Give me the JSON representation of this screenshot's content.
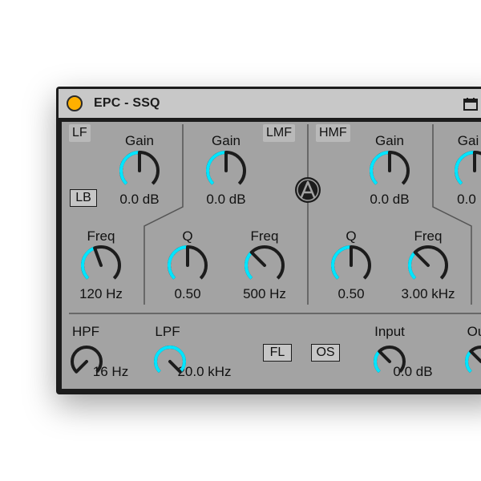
{
  "device": {
    "title": "EPC - SSQ",
    "accent": "#00e5ff",
    "power_color": "#ffb000",
    "icons": {
      "save": "save-icon",
      "more": "more-icon",
      "logo": "brand-logo-icon"
    }
  },
  "bands": {
    "lf": {
      "tag": "LF",
      "gain_label": "Gain",
      "gain_value": "0.0 dB",
      "freq_label": "Freq",
      "freq_value": "120 Hz",
      "lb_label": "LB"
    },
    "lmf": {
      "tag": "LMF",
      "gain_label": "Gain",
      "gain_value": "0.0 dB",
      "q_label": "Q",
      "q_value": "0.50",
      "freq_label": "Freq",
      "freq_value": "500 Hz"
    },
    "hmf": {
      "tag": "HMF",
      "gain_label": "Gain",
      "gain_value": "0.0 dB",
      "q_label": "Q",
      "q_value": "0.50",
      "freq_label": "Freq",
      "freq_value": "3.00 kHz"
    },
    "hf": {
      "gain_label": "Gai",
      "gain_value": "0.0"
    }
  },
  "bottom": {
    "hpf_label": "HPF",
    "hpf_value": "16 Hz",
    "lpf_label": "LPF",
    "lpf_value": "20.0 kHz",
    "fl_label": "FL",
    "os_label": "OS",
    "input_label": "Input",
    "input_value": "0.0 dB",
    "output_label": "Ou"
  }
}
